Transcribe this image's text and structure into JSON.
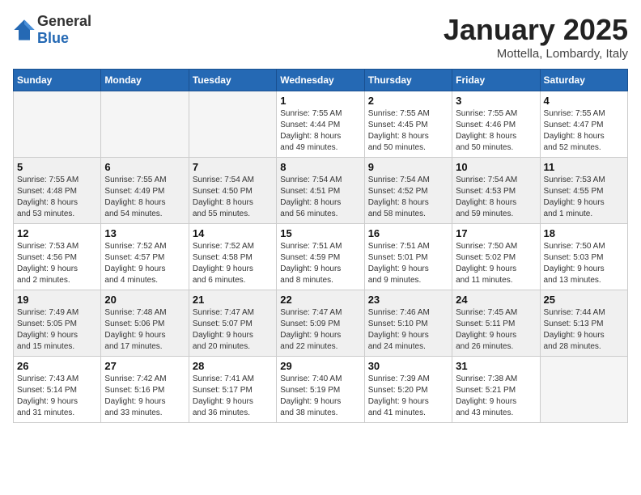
{
  "header": {
    "logo_general": "General",
    "logo_blue": "Blue",
    "month_title": "January 2025",
    "subtitle": "Mottella, Lombardy, Italy"
  },
  "days_of_week": [
    "Sunday",
    "Monday",
    "Tuesday",
    "Wednesday",
    "Thursday",
    "Friday",
    "Saturday"
  ],
  "weeks": [
    {
      "alt": false,
      "days": [
        {
          "num": "",
          "info": ""
        },
        {
          "num": "",
          "info": ""
        },
        {
          "num": "",
          "info": ""
        },
        {
          "num": "1",
          "info": "Sunrise: 7:55 AM\nSunset: 4:44 PM\nDaylight: 8 hours\nand 49 minutes."
        },
        {
          "num": "2",
          "info": "Sunrise: 7:55 AM\nSunset: 4:45 PM\nDaylight: 8 hours\nand 50 minutes."
        },
        {
          "num": "3",
          "info": "Sunrise: 7:55 AM\nSunset: 4:46 PM\nDaylight: 8 hours\nand 50 minutes."
        },
        {
          "num": "4",
          "info": "Sunrise: 7:55 AM\nSunset: 4:47 PM\nDaylight: 8 hours\nand 52 minutes."
        }
      ]
    },
    {
      "alt": true,
      "days": [
        {
          "num": "5",
          "info": "Sunrise: 7:55 AM\nSunset: 4:48 PM\nDaylight: 8 hours\nand 53 minutes."
        },
        {
          "num": "6",
          "info": "Sunrise: 7:55 AM\nSunset: 4:49 PM\nDaylight: 8 hours\nand 54 minutes."
        },
        {
          "num": "7",
          "info": "Sunrise: 7:54 AM\nSunset: 4:50 PM\nDaylight: 8 hours\nand 55 minutes."
        },
        {
          "num": "8",
          "info": "Sunrise: 7:54 AM\nSunset: 4:51 PM\nDaylight: 8 hours\nand 56 minutes."
        },
        {
          "num": "9",
          "info": "Sunrise: 7:54 AM\nSunset: 4:52 PM\nDaylight: 8 hours\nand 58 minutes."
        },
        {
          "num": "10",
          "info": "Sunrise: 7:54 AM\nSunset: 4:53 PM\nDaylight: 8 hours\nand 59 minutes."
        },
        {
          "num": "11",
          "info": "Sunrise: 7:53 AM\nSunset: 4:55 PM\nDaylight: 9 hours\nand 1 minute."
        }
      ]
    },
    {
      "alt": false,
      "days": [
        {
          "num": "12",
          "info": "Sunrise: 7:53 AM\nSunset: 4:56 PM\nDaylight: 9 hours\nand 2 minutes."
        },
        {
          "num": "13",
          "info": "Sunrise: 7:52 AM\nSunset: 4:57 PM\nDaylight: 9 hours\nand 4 minutes."
        },
        {
          "num": "14",
          "info": "Sunrise: 7:52 AM\nSunset: 4:58 PM\nDaylight: 9 hours\nand 6 minutes."
        },
        {
          "num": "15",
          "info": "Sunrise: 7:51 AM\nSunset: 4:59 PM\nDaylight: 9 hours\nand 8 minutes."
        },
        {
          "num": "16",
          "info": "Sunrise: 7:51 AM\nSunset: 5:01 PM\nDaylight: 9 hours\nand 9 minutes."
        },
        {
          "num": "17",
          "info": "Sunrise: 7:50 AM\nSunset: 5:02 PM\nDaylight: 9 hours\nand 11 minutes."
        },
        {
          "num": "18",
          "info": "Sunrise: 7:50 AM\nSunset: 5:03 PM\nDaylight: 9 hours\nand 13 minutes."
        }
      ]
    },
    {
      "alt": true,
      "days": [
        {
          "num": "19",
          "info": "Sunrise: 7:49 AM\nSunset: 5:05 PM\nDaylight: 9 hours\nand 15 minutes."
        },
        {
          "num": "20",
          "info": "Sunrise: 7:48 AM\nSunset: 5:06 PM\nDaylight: 9 hours\nand 17 minutes."
        },
        {
          "num": "21",
          "info": "Sunrise: 7:47 AM\nSunset: 5:07 PM\nDaylight: 9 hours\nand 20 minutes."
        },
        {
          "num": "22",
          "info": "Sunrise: 7:47 AM\nSunset: 5:09 PM\nDaylight: 9 hours\nand 22 minutes."
        },
        {
          "num": "23",
          "info": "Sunrise: 7:46 AM\nSunset: 5:10 PM\nDaylight: 9 hours\nand 24 minutes."
        },
        {
          "num": "24",
          "info": "Sunrise: 7:45 AM\nSunset: 5:11 PM\nDaylight: 9 hours\nand 26 minutes."
        },
        {
          "num": "25",
          "info": "Sunrise: 7:44 AM\nSunset: 5:13 PM\nDaylight: 9 hours\nand 28 minutes."
        }
      ]
    },
    {
      "alt": false,
      "days": [
        {
          "num": "26",
          "info": "Sunrise: 7:43 AM\nSunset: 5:14 PM\nDaylight: 9 hours\nand 31 minutes."
        },
        {
          "num": "27",
          "info": "Sunrise: 7:42 AM\nSunset: 5:16 PM\nDaylight: 9 hours\nand 33 minutes."
        },
        {
          "num": "28",
          "info": "Sunrise: 7:41 AM\nSunset: 5:17 PM\nDaylight: 9 hours\nand 36 minutes."
        },
        {
          "num": "29",
          "info": "Sunrise: 7:40 AM\nSunset: 5:19 PM\nDaylight: 9 hours\nand 38 minutes."
        },
        {
          "num": "30",
          "info": "Sunrise: 7:39 AM\nSunset: 5:20 PM\nDaylight: 9 hours\nand 41 minutes."
        },
        {
          "num": "31",
          "info": "Sunrise: 7:38 AM\nSunset: 5:21 PM\nDaylight: 9 hours\nand 43 minutes."
        },
        {
          "num": "",
          "info": ""
        }
      ]
    }
  ]
}
